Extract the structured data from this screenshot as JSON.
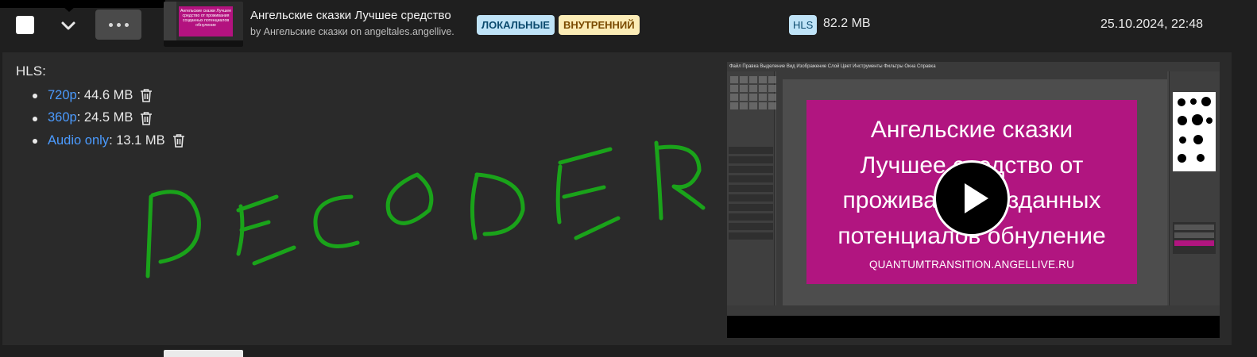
{
  "row": {
    "title": "Ангельские сказки Лучшее средство",
    "subtitle": "by Ангельские сказки on angeltales.angellive.",
    "badges": {
      "local": "ЛОКАЛЬНЫЕ",
      "internal": "ВНУТРЕННИЙ",
      "format": "HLS"
    },
    "size": "82.2 MB",
    "date": "25.10.2024, 22:48",
    "thumbnail_text": "Ангельские сказки Лучшее средство от проживания созданных потенциалов обнуление"
  },
  "details": {
    "section_label": "HLS:",
    "variants": [
      {
        "name": "720p",
        "size": ": 44.6 MB"
      },
      {
        "name": "360p",
        "size": ": 24.5 MB"
      },
      {
        "name": "Audio only",
        "size": ": 13.1 MB"
      }
    ],
    "doodle_text": "DECODER"
  },
  "player": {
    "menubar": "Файл  Правка  Выделение  Вид  Изображение  Слой  Цвет  Инструменты  Фильтры  Окна  Справка",
    "card_lines": [
      "Ангельские сказки",
      "Лучшее средство от",
      "проживания созданных",
      "потенциалов обнуление"
    ],
    "card_url": "QUANTUMTRANSITION.ANGELLIVE.RU"
  },
  "colors": {
    "accent_link": "#4b9bff",
    "magenta": "#b11580",
    "doodle_green": "#1aa31a"
  },
  "icons": [
    "chevron-down-icon",
    "more-icon",
    "trash-icon",
    "play-icon"
  ]
}
